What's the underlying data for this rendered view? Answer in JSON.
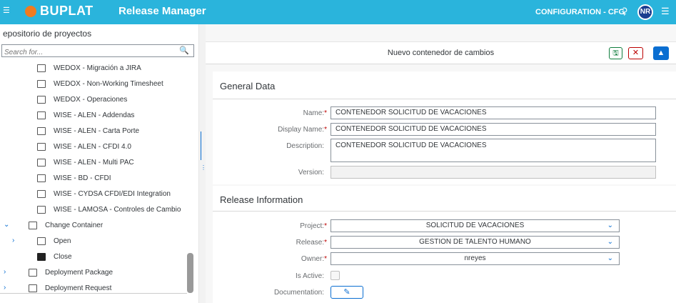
{
  "header": {
    "brand": "BUPLAT",
    "app_title": "Release Manager",
    "configuration": "CONFIGURATION - CFG",
    "avatar_initials": "NR",
    "accent": "#2ab4dc"
  },
  "sidebar": {
    "title": "epositorio de proyectos",
    "search_placeholder": "Search for...",
    "items": [
      {
        "label": "WEDOX - Migración a JIRA"
      },
      {
        "label": "WEDOX - Non-Working Timesheet"
      },
      {
        "label": "WEDOX - Operaciones"
      },
      {
        "label": "WISE - ALEN - Addendas"
      },
      {
        "label": "WISE - ALEN - Carta Porte"
      },
      {
        "label": "WISE - ALEN - CFDI 4.0"
      },
      {
        "label": "WISE - ALEN - Multi PAC"
      },
      {
        "label": "WISE - BD - CFDI"
      },
      {
        "label": "WISE - CYDSA CFDI/EDI Integration"
      },
      {
        "label": "WISE - LAMOSA - Controles de Cambio"
      },
      {
        "label": "Change Container"
      },
      {
        "label": "Open"
      },
      {
        "label": "Close"
      },
      {
        "label": "Deployment Package"
      },
      {
        "label": "Deployment Request"
      }
    ]
  },
  "detail": {
    "title": "Nuevo contenedor de cambios",
    "general": {
      "section_title": "General Data",
      "name_label": "Name:",
      "name_value": "CONTENEDOR SOLICITUD DE VACACIONES",
      "display_name_label": "Display Name:",
      "display_name_value": "CONTENEDOR SOLICITUD DE VACACIONES",
      "description_label": "Description:",
      "description_value": "CONTENEDOR SOLICITUD DE VACACIONES",
      "version_label": "Version:",
      "version_value": ""
    },
    "release": {
      "section_title": "Release Information",
      "project_label": "Project:",
      "project_value": "SOLICITUD DE VACACIONES",
      "release_label": "Release:",
      "release_value": "GESTION DE TALENTO HUMANO",
      "owner_label": "Owner:",
      "owner_value": "nreyes",
      "is_active_label": "Is Active:",
      "documentation_label": "Documentation:"
    },
    "required_mark": "*"
  }
}
